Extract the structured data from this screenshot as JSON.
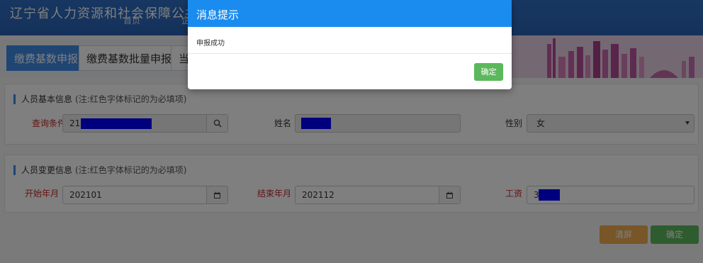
{
  "header": {
    "site_title": "辽宁省人力资源和社会保障公共服务平",
    "nav_home": "首页",
    "nav_partial": "企"
  },
  "tabs": [
    {
      "label": "缴费基数申报",
      "active": true
    },
    {
      "label": "缴费基数批量申报",
      "active": false
    },
    {
      "label": "当",
      "active": false
    }
  ],
  "basic_info": {
    "section_title": "人员基本信息",
    "section_note": "(注:红色字体标记的为必填项)",
    "query_label": "查询条件",
    "query_value": "210",
    "name_label": "姓名",
    "gender_label": "性别",
    "gender_value": "女"
  },
  "change_info": {
    "section_title": "人员变更信息",
    "section_note": "(注:红色字体标记的为必填项)",
    "start_label": "开始年月",
    "start_value": "202101",
    "end_label": "结束年月",
    "end_value": "202112",
    "salary_label": "工资",
    "salary_value": "3"
  },
  "actions": {
    "clear_label": "清屏",
    "confirm_label": "确定"
  },
  "modal": {
    "title": "消息提示",
    "message": "申报成功",
    "ok_label": "确定"
  },
  "colors": {
    "accent": "#3e8be6",
    "modal_header": "#1a8cf0",
    "required_label": "#c62828",
    "success": "#5cb85c",
    "warning": "#f0ad4e",
    "redaction": "#0000ff"
  }
}
